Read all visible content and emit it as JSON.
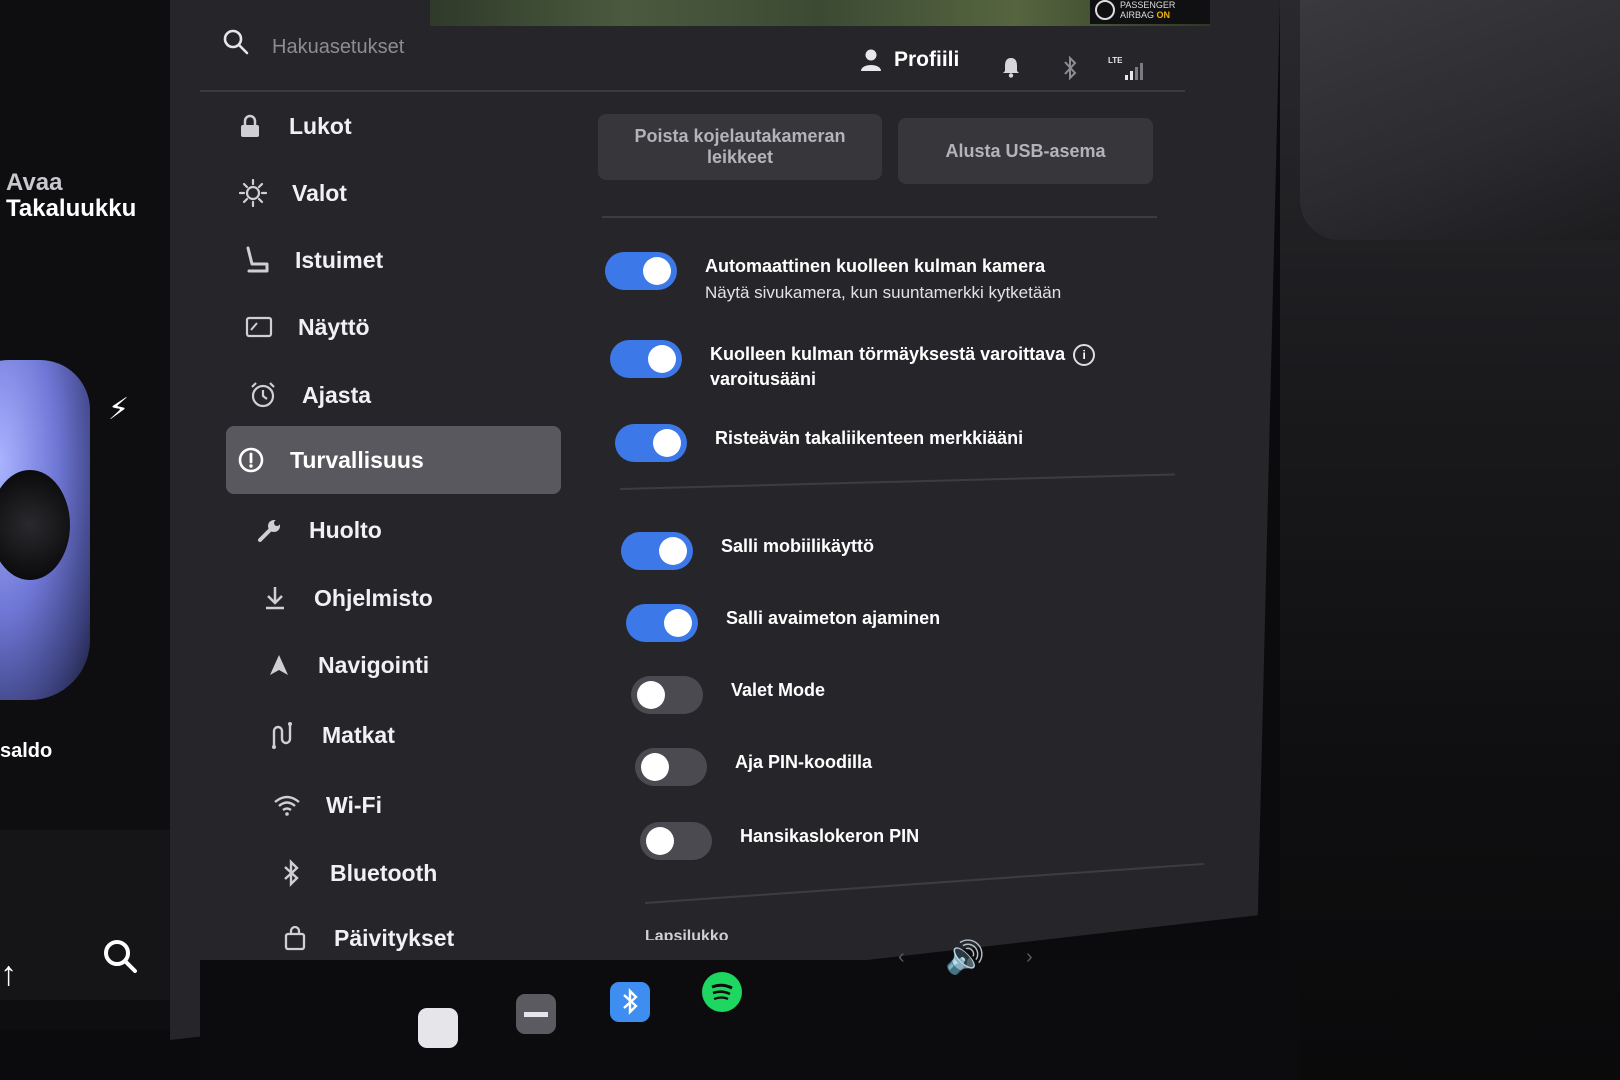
{
  "left_panel": {
    "trunk_line1": "Avaa",
    "trunk_line2": "Takaluukku",
    "range_label": "saldo",
    "bolt_icon": "lightning-bolt-icon"
  },
  "header": {
    "search_placeholder": "Hakuasetukset",
    "profile_label": "Profiili",
    "airbag_line1": "PASSENGER",
    "airbag_line2": "AIRBAG",
    "airbag_status": "ON",
    "lte_label": "LTE"
  },
  "sidebar": {
    "items": [
      {
        "label": "Lukot",
        "icon": "lock-icon"
      },
      {
        "label": "Valot",
        "icon": "sun-icon"
      },
      {
        "label": "Istuimet",
        "icon": "seat-icon"
      },
      {
        "label": "Näyttö",
        "icon": "display-icon"
      },
      {
        "label": "Ajasta",
        "icon": "alarm-clock-icon"
      },
      {
        "label": "Turvallisuus",
        "icon": "alert-circle-icon",
        "active": true
      },
      {
        "label": "Huolto",
        "icon": "wrench-icon"
      },
      {
        "label": "Ohjelmisto",
        "icon": "download-icon"
      },
      {
        "label": "Navigointi",
        "icon": "navigation-arrow-icon"
      },
      {
        "label": "Matkat",
        "icon": "trips-icon"
      },
      {
        "label": "Wi-Fi",
        "icon": "wifi-icon"
      },
      {
        "label": "Bluetooth",
        "icon": "bluetooth-icon"
      },
      {
        "label": "Päivitykset",
        "icon": "shopping-bag-icon"
      }
    ]
  },
  "actions": {
    "delete_dashcam_clips": "Poista kojelautakameran leikkeet",
    "format_usb": "Alusta USB-asema"
  },
  "settings": {
    "blind_spot_camera": {
      "title": "Automaattinen kuolleen kulman kamera",
      "subtitle": "Näytä sivukamera, kun suuntamerkki kytketään",
      "on": true
    },
    "blind_spot_chime": {
      "title_line1": "Kuolleen kulman törmäyksestä varoittava",
      "title_line2": "varoitusääni",
      "on": true
    },
    "cross_traffic_chime": {
      "title": "Risteävän takaliikenteen merkkiääni",
      "on": true
    },
    "mobile_access": {
      "title": "Salli mobiilikäyttö",
      "on": true
    },
    "keyless_driving": {
      "title": "Salli avaimeton ajaminen",
      "on": true
    },
    "valet_mode": {
      "title": "Valet Mode",
      "on": false
    },
    "pin_to_drive": {
      "title": "Aja PIN-koodilla",
      "on": false
    },
    "glovebox_pin": {
      "title": "Hansikaslokeron PIN",
      "on": false
    }
  },
  "bottom_bar": {
    "partial_label": "Lapsilukko",
    "apps": [
      "calendar-app-icon",
      "dashcam-app-icon",
      "bluetooth-app-icon",
      "spotify-app-icon"
    ],
    "volume_icon": "volume-icon"
  },
  "colors": {
    "toggle_on": "#3d78e8",
    "toggle_off": "#4a4a50",
    "active_nav": "#58585e",
    "screen_bg": "#26262a"
  }
}
